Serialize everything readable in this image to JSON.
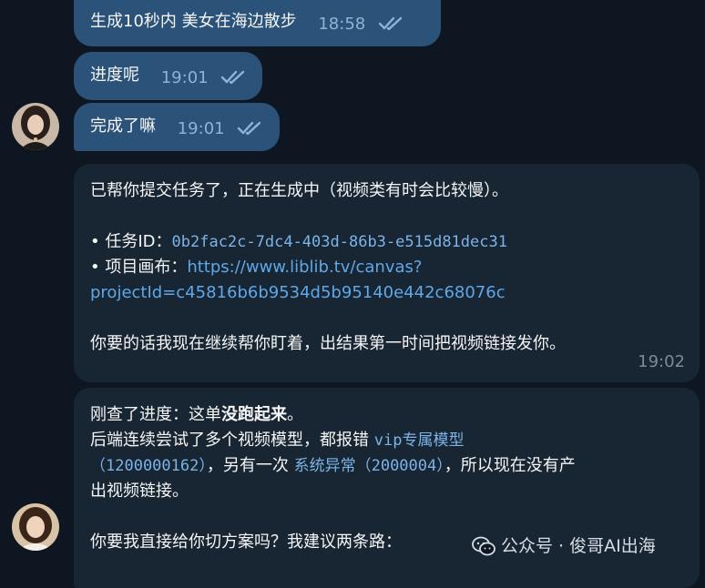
{
  "messages": {
    "m1": {
      "text": "生成10秒内 美女在海边散步",
      "time": "18:58"
    },
    "m2": {
      "text": "进度呢",
      "time": "19:01"
    },
    "m3": {
      "text": "完成了嘛",
      "time": "19:01"
    },
    "r1": {
      "line1": "已帮你提交任务了，正在生成中（视频类有时会比较慢）。",
      "task_label": "• 任务ID：",
      "task_id": "0b2fac2c-7dc4-403d-86b3-e515d81dec31",
      "canvas_label": "• 项目画布：",
      "canvas_url_1": "https://www.liblib.tv/canvas?",
      "canvas_url_2": "projectId=c45816b6b9534d5b95140e442c68076c",
      "line_last": "你要的话我现在继续帮你盯着，出结果第一时间把视频链接发你。",
      "time": "19:02"
    },
    "r2": {
      "l1_a": "刚查了进度：这单",
      "l1_b": "没跑起来",
      "l1_c": "。",
      "l2_a": "后端连续尝试了多个视频模型，都报错 ",
      "l2_b": "vip专属模型",
      "l3_a": "（1200000162）",
      "l3_b": "，另有一次 ",
      "l3_c": "系统异常（2000004）",
      "l3_d": "，所以现在没有产",
      "l4": "出视频链接。",
      "l5": "你要我直接给你切方案吗？我建议两条路："
    }
  },
  "watermark": {
    "text": "公众号 · 俊哥AI出海"
  },
  "colors": {
    "background": "#0e1621",
    "outgoing_bubble": "#2b5278",
    "incoming_bubble": "#182533",
    "link": "#5fa8e8",
    "read_check": "#8fb3d6"
  },
  "icons": {
    "read_receipt": "double-check-icon",
    "watermark": "wechat-icon"
  }
}
